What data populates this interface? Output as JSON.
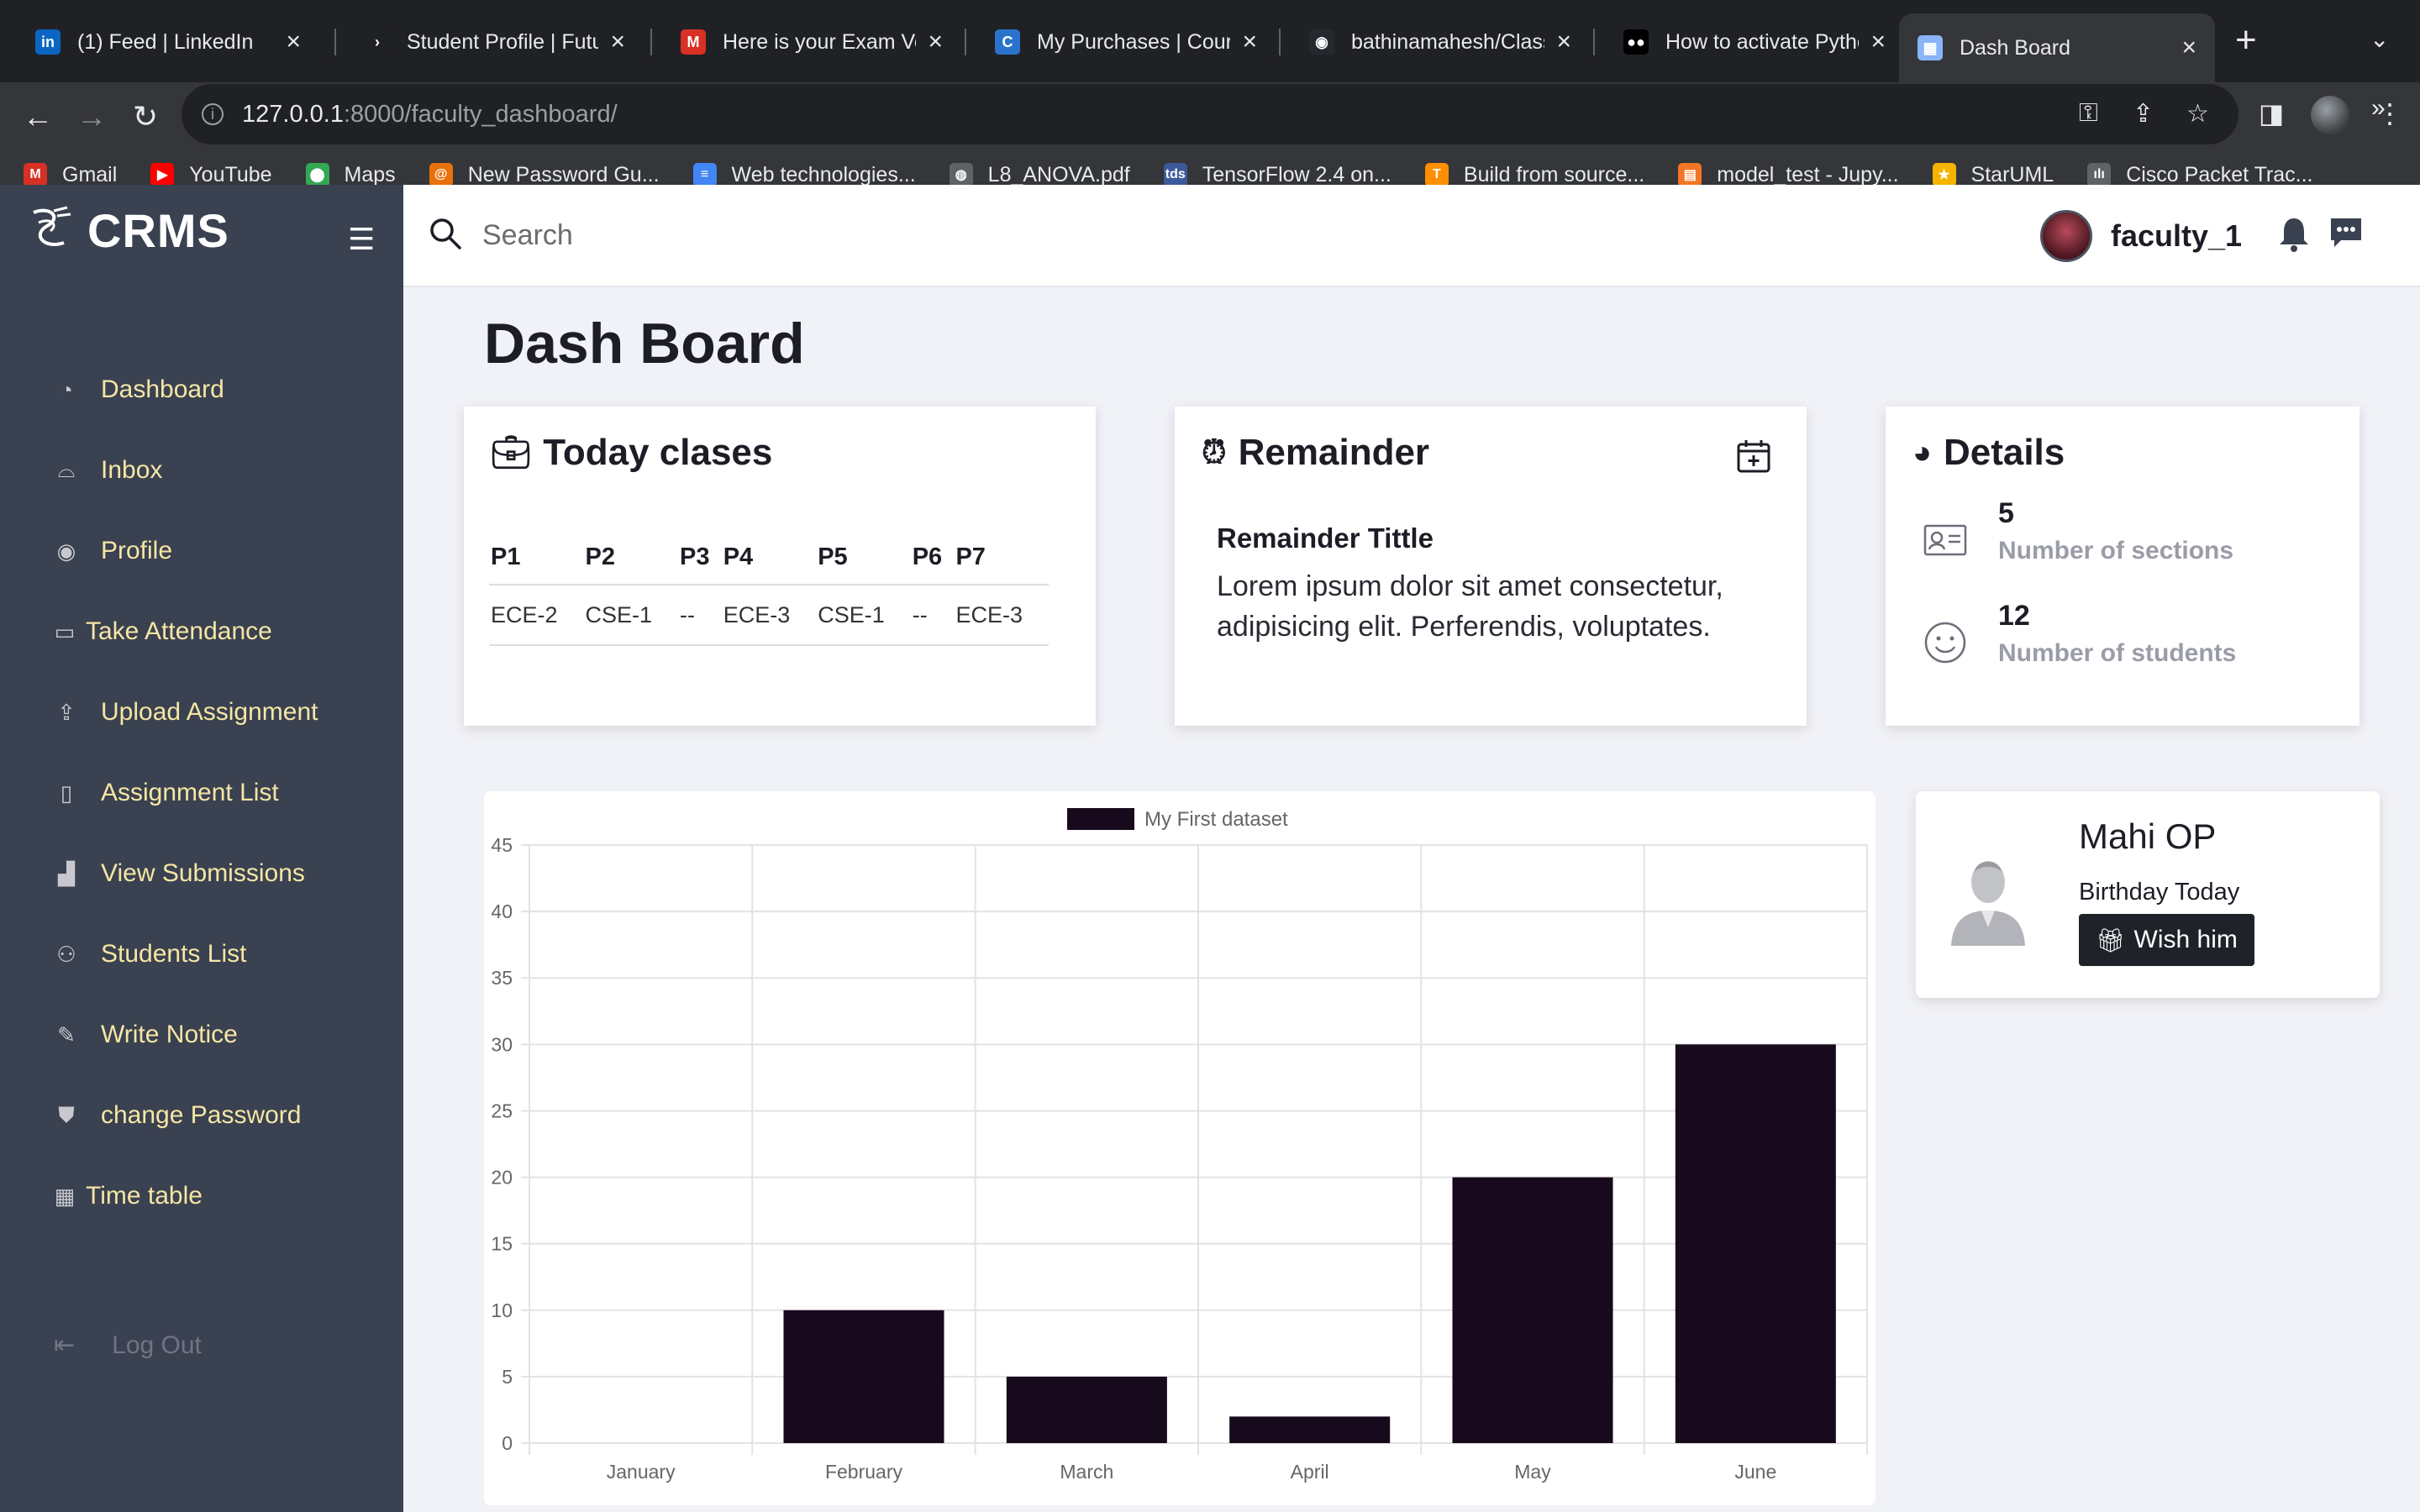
{
  "browser": {
    "tabs": [
      {
        "title": "(1) Feed | LinkedIn",
        "icon": "linkedin-icon",
        "color": "#0a66c2",
        "glyph": "in"
      },
      {
        "title": "Student Profile | Futur",
        "icon": "arrow-icon",
        "color": "#202124",
        "glyph": "›"
      },
      {
        "title": "Here is your Exam Vo",
        "icon": "gmail-icon",
        "color": "#d93025",
        "glyph": "M"
      },
      {
        "title": "My Purchases | Cours",
        "icon": "coursera-icon",
        "color": "#2a73cc",
        "glyph": "C"
      },
      {
        "title": "bathinamahesh/Class",
        "icon": "github-icon",
        "color": "#24292f",
        "glyph": "◉"
      },
      {
        "title": "How to activate Pytho",
        "icon": "medium-icon",
        "color": "#000000",
        "glyph": "●●"
      },
      {
        "title": "Dash Board",
        "icon": "page-icon",
        "color": "#8ab4f8",
        "glyph": "▦"
      }
    ],
    "new_tab": "+",
    "url_host": "127.0.0.1",
    "url_rest": ":8000/faculty_dashboard/",
    "bookmarks": [
      {
        "label": "Gmail",
        "color": "#d93025",
        "glyph": "M"
      },
      {
        "label": "YouTube",
        "color": "#ff0000",
        "glyph": "▶"
      },
      {
        "label": "Maps",
        "color": "#34a853",
        "glyph": "⬤"
      },
      {
        "label": "New Password Gu...",
        "color": "#e8710a",
        "glyph": "@"
      },
      {
        "label": "Web technologies...",
        "color": "#4285f4",
        "glyph": "≡"
      },
      {
        "label": "L8_ANOVA.pdf",
        "color": "#5f6368",
        "glyph": "◍"
      },
      {
        "label": "TensorFlow 2.4 on...",
        "color": "#3c5a99",
        "glyph": "tds"
      },
      {
        "label": "Build from source...",
        "color": "#ff8f00",
        "glyph": "T"
      },
      {
        "label": "model_test - Jupy...",
        "color": "#f37626",
        "glyph": "▤"
      },
      {
        "label": "StarUML",
        "color": "#f4b400",
        "glyph": "★"
      },
      {
        "label": "Cisco Packet Trac...",
        "color": "#5f6368",
        "glyph": "ılı"
      }
    ],
    "more_bookmarks": "»"
  },
  "app": {
    "brand": "CRMS",
    "search_placeholder": "Search",
    "username": "faculty_1",
    "page_title": "Dash Board"
  },
  "sidebar": {
    "items": [
      {
        "label": "Dashboard",
        "icon": "gauge-icon",
        "glyph": "◔"
      },
      {
        "label": "Inbox",
        "icon": "inbox-icon",
        "glyph": "⌓"
      },
      {
        "label": "Profile",
        "icon": "user-circle-icon",
        "glyph": "◉"
      },
      {
        "label": "Take Attendance",
        "icon": "id-card-icon",
        "glyph": "▭"
      },
      {
        "label": "Upload Assignment",
        "icon": "upload-icon",
        "glyph": "⇪"
      },
      {
        "label": "Assignment List",
        "icon": "book-icon",
        "glyph": "▯"
      },
      {
        "label": "View Submissions",
        "icon": "bar-chart-icon",
        "glyph": "▟"
      },
      {
        "label": "Students List",
        "icon": "users-icon",
        "glyph": "⚇"
      },
      {
        "label": "Write Notice",
        "icon": "edit-icon",
        "glyph": "✎"
      },
      {
        "label": "change Password",
        "icon": "shield-icon",
        "glyph": "⛊"
      },
      {
        "label": "Time table",
        "icon": "grid-icon",
        "glyph": "▦"
      }
    ],
    "logout": "Log Out"
  },
  "today_classes": {
    "title": "Today clases",
    "headers": [
      "P1",
      "P2",
      "P3",
      "P4",
      "P5",
      "P6",
      "P7"
    ],
    "row": [
      "ECE-2",
      "CSE-1",
      "--",
      "ECE-3",
      "CSE-1",
      "--",
      "ECE-3"
    ]
  },
  "remainder": {
    "title": "Remainder",
    "item_title": "Remainder Tittle",
    "item_text": "Lorem ipsum dolor sit amet consectetur, adipisicing elit. Perferendis, voluptates."
  },
  "details": {
    "title": "Details",
    "sections_count": "5",
    "sections_label": "Number of sections",
    "students_count": "12",
    "students_label": "Number of students"
  },
  "birthday": {
    "name": "Mahi OP",
    "subtitle": "Birthday Today",
    "button": "Wish him"
  },
  "chart_data": {
    "type": "bar",
    "categories": [
      "January",
      "February",
      "March",
      "April",
      "May",
      "June"
    ],
    "series": [
      {
        "name": "My First dataset",
        "values": [
          0,
          10,
          5,
          2,
          20,
          30
        ]
      }
    ],
    "ylim": [
      0,
      45
    ],
    "yticks": [
      0,
      5,
      10,
      15,
      20,
      25,
      30,
      35,
      40,
      45
    ],
    "grid": true,
    "legend": "top-center",
    "bar_color": "#170a1c"
  }
}
